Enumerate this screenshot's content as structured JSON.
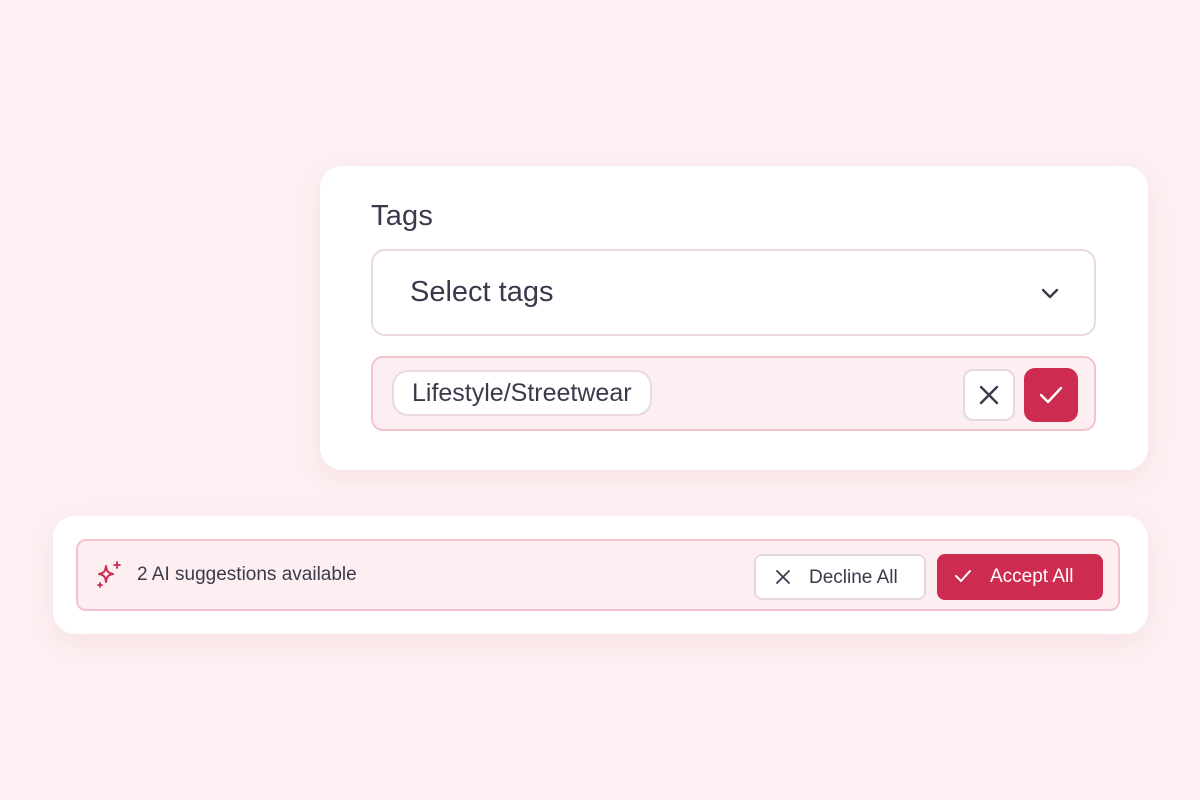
{
  "tags": {
    "label": "Tags",
    "select_placeholder": "Select tags",
    "suggested_tag": "Lifestyle/Streetwear"
  },
  "ai_bar": {
    "text": "2 AI suggestions available",
    "decline_all_label": "Decline All",
    "accept_all_label": "Accept All"
  },
  "icons": {
    "dropdown": "chevron-down-icon",
    "decline": "close-icon",
    "accept": "check-icon",
    "ai": "sparkle-icon"
  },
  "colors": {
    "background": "#fdf0f2",
    "accent": "#cd2b50",
    "suggestion_bg": "#fdeef1",
    "suggestion_border": "#f3c3cc",
    "text": "#3b3a4d"
  }
}
